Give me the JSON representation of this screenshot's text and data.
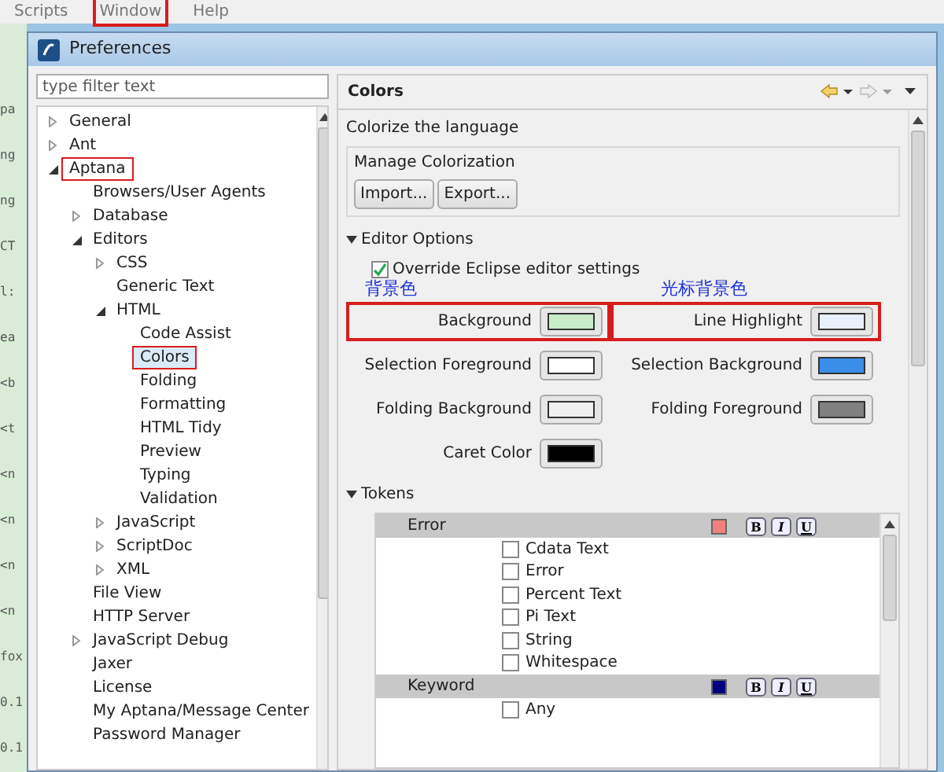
{
  "menubar": [
    {
      "label": "Scripts",
      "annotated": false
    },
    {
      "label": "Window",
      "annotated": true
    },
    {
      "label": "Help",
      "annotated": false
    }
  ],
  "background_editor": {
    "fragments": [
      "pa",
      "ng",
      "ng",
      "CT",
      "l:",
      "ea",
      "<b",
      "<t",
      "<n",
      "<n",
      "<n",
      "<n",
      "fox",
      "0.1",
      "0.1"
    ]
  },
  "dialog": {
    "title": "Preferences",
    "filter": {
      "placeholder": "type filter text"
    },
    "tree": [
      {
        "label": "General",
        "expanded": false,
        "selected": false,
        "annotated": false
      },
      {
        "label": "Ant",
        "expanded": false,
        "selected": false,
        "annotated": false
      },
      {
        "label": "Aptana",
        "expanded": true,
        "selected": false,
        "annotated": true,
        "children": [
          {
            "label": "Browsers/User Agents",
            "selected": false,
            "annotated": false
          },
          {
            "label": "Database",
            "expanded": false,
            "selected": false,
            "annotated": false
          },
          {
            "label": "Editors",
            "expanded": true,
            "selected": false,
            "annotated": false,
            "children": [
              {
                "label": "CSS",
                "expanded": false,
                "selected": false,
                "annotated": false
              },
              {
                "label": "Generic Text",
                "selected": false,
                "annotated": false
              },
              {
                "label": "HTML",
                "expanded": true,
                "selected": false,
                "annotated": false,
                "children": [
                  {
                    "label": "Code Assist",
                    "selected": false,
                    "annotated": false
                  },
                  {
                    "label": "Colors",
                    "selected": true,
                    "annotated": true
                  },
                  {
                    "label": "Folding",
                    "selected": false,
                    "annotated": false
                  },
                  {
                    "label": "Formatting",
                    "selected": false,
                    "annotated": false
                  },
                  {
                    "label": "HTML Tidy",
                    "selected": false,
                    "annotated": false
                  },
                  {
                    "label": "Preview",
                    "selected": false,
                    "annotated": false
                  },
                  {
                    "label": "Typing",
                    "selected": false,
                    "annotated": false
                  },
                  {
                    "label": "Validation",
                    "selected": false,
                    "annotated": false
                  }
                ]
              },
              {
                "label": "JavaScript",
                "expanded": false,
                "selected": false,
                "annotated": false
              },
              {
                "label": "ScriptDoc",
                "expanded": false,
                "selected": false,
                "annotated": false
              },
              {
                "label": "XML",
                "expanded": false,
                "selected": false,
                "annotated": false
              }
            ]
          },
          {
            "label": "File View",
            "selected": false,
            "annotated": false
          },
          {
            "label": "HTTP Server",
            "selected": false,
            "annotated": false
          },
          {
            "label": "JavaScript Debug",
            "expanded": false,
            "selected": false,
            "annotated": false
          },
          {
            "label": "Jaxer",
            "selected": false,
            "annotated": false
          },
          {
            "label": "License",
            "selected": false,
            "annotated": false
          },
          {
            "label": "My Aptana/Message Center",
            "selected": false,
            "annotated": false
          },
          {
            "label": "Password Manager",
            "selected": false,
            "annotated": false
          }
        ]
      }
    ],
    "page": {
      "title": "Colors",
      "description": "Colorize the language",
      "manage": {
        "label": "Manage Colorization",
        "buttons": [
          "Import...",
          "Export..."
        ]
      },
      "editor_options": {
        "label": "Editor Options",
        "expanded": true,
        "override": {
          "label": "Override Eclipse editor settings",
          "checked": true
        },
        "colors": [
          {
            "label": "Background",
            "color": "#c8ecc8",
            "annotated": true,
            "annotation": "背景色"
          },
          {
            "label": "Line Highlight",
            "color": "#e8f0fc",
            "annotated": true,
            "annotation": "光标背景色"
          },
          {
            "label": "Selection Foreground",
            "color": "#ffffff",
            "annotated": false
          },
          {
            "label": "Selection Background",
            "color": "#3a8ee8",
            "annotated": false
          },
          {
            "label": "Folding Background",
            "color": "#f0f0f0",
            "annotated": false
          },
          {
            "label": "Folding Foreground",
            "color": "#808080",
            "annotated": false
          },
          {
            "label": "Caret Color",
            "color": "#000000",
            "annotated": false
          }
        ]
      },
      "tokens": {
        "label": "Tokens",
        "expanded": true,
        "groups": [
          {
            "name": "Error",
            "color": "#f08080",
            "style_buttons": [
              "B",
              "I",
              "U"
            ],
            "items": [
              {
                "label": "Cdata Text",
                "checked": false
              },
              {
                "label": "Error",
                "checked": false
              },
              {
                "label": "Percent Text",
                "checked": false
              },
              {
                "label": "Pi Text",
                "checked": false
              },
              {
                "label": "String",
                "checked": false
              },
              {
                "label": "Whitespace",
                "checked": false
              }
            ]
          },
          {
            "name": "Keyword",
            "color": "#000080",
            "style_buttons": [
              "B",
              "I",
              "U"
            ],
            "items": [
              {
                "label": "Any",
                "checked": false
              }
            ]
          }
        ]
      }
    }
  }
}
